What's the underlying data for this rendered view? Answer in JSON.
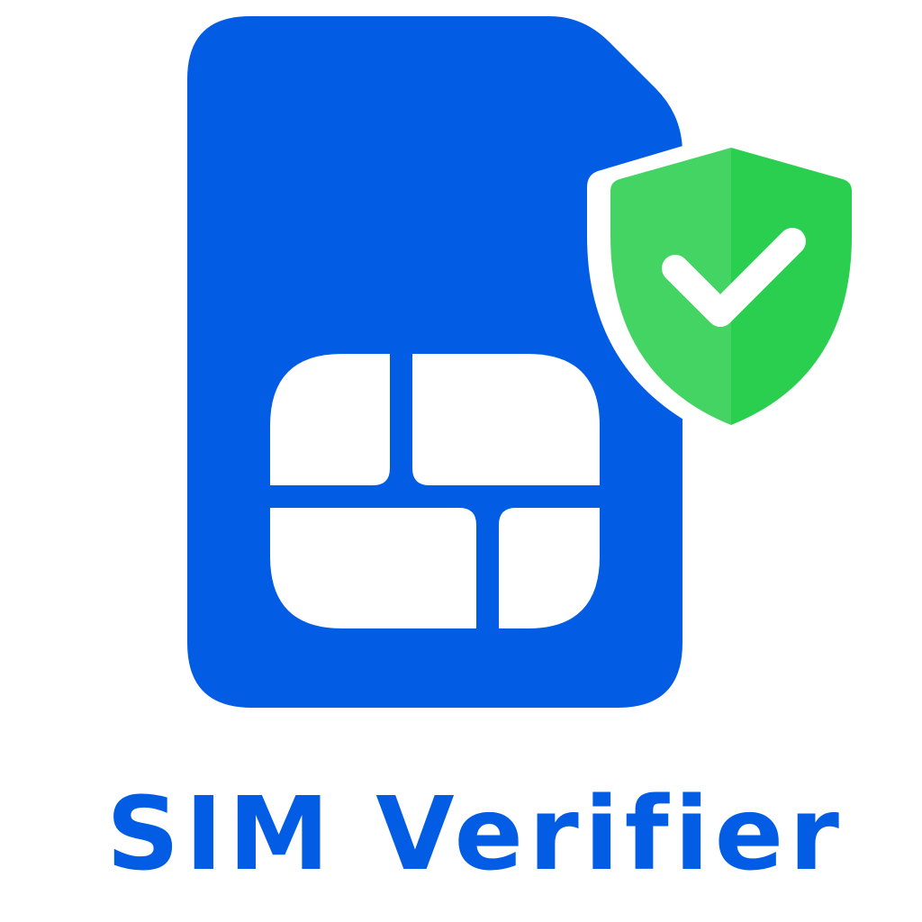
{
  "app": {
    "name": "SIM Verifier"
  },
  "icons": {
    "sim_card": "sim-card-icon",
    "shield": "shield-icon",
    "checkmark": "checkmark-icon"
  },
  "colors": {
    "sim_blue": "#035ce4",
    "shield_green_light": "#44d463",
    "shield_green_dark": "#2bcf50",
    "chip_white": "#ffffff",
    "background": "#ffffff",
    "text_blue": "#035ce4"
  }
}
